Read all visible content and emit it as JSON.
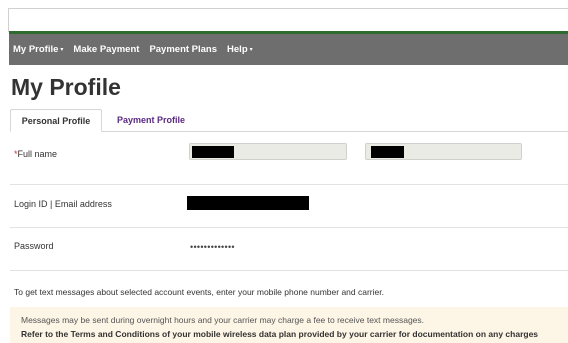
{
  "nav": {
    "items": [
      {
        "label": "My Profile",
        "dropdown": true
      },
      {
        "label": "Make Payment",
        "dropdown": false
      },
      {
        "label": "Payment Plans",
        "dropdown": false
      },
      {
        "label": "Help",
        "dropdown": true
      }
    ],
    "caret": "▾",
    "background": "#6e6e6e",
    "accent": "#2e6b2e"
  },
  "page": {
    "title": "My Profile"
  },
  "tabs": [
    {
      "label": "Personal Profile",
      "active": true
    },
    {
      "label": "Payment Profile",
      "active": false
    }
  ],
  "form": {
    "full_name": {
      "required_marker": "*",
      "label": "Full name"
    },
    "login": {
      "label": "Login ID | Email address"
    },
    "password": {
      "label": "Password",
      "value": "•••••••••••••"
    }
  },
  "sms": {
    "intro": "To get text messages about selected account events, enter your mobile phone number and carrier.",
    "notice_line1": "Messages may be sent during overnight hours and your carrier may charge a fee to receive text messages.",
    "notice_line2": "Refer to the Terms and Conditions of your mobile wireless data plan provided by your carrier for documentation on any charges"
  }
}
